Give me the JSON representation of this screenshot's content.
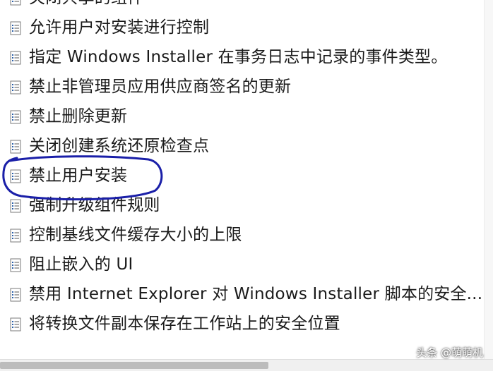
{
  "policies": [
    {
      "label": "关闭共享的组件"
    },
    {
      "label": "允许用户对安装进行控制"
    },
    {
      "label": "指定 Windows Installer 在事务日志中记录的事件类型。"
    },
    {
      "label": "禁止非管理员应用供应商签名的更新"
    },
    {
      "label": "禁止删除更新"
    },
    {
      "label": "关闭创建系统还原检查点"
    },
    {
      "label": "禁止用户安装"
    },
    {
      "label": "强制升级组件规则"
    },
    {
      "label": "控制基线文件缓存大小的上限"
    },
    {
      "label": "阻止嵌入的 UI"
    },
    {
      "label": "禁用 Internet Explorer 对 Windows Installer 脚本的安全..."
    },
    {
      "label": "将转换文件副本保存在工作站上的安全位置"
    }
  ],
  "icon": "policy-setting-icon",
  "highlighted_item": "禁止用户安装",
  "annotation_color": "#1a1fa8",
  "watermark": "头条 @萌萌机"
}
